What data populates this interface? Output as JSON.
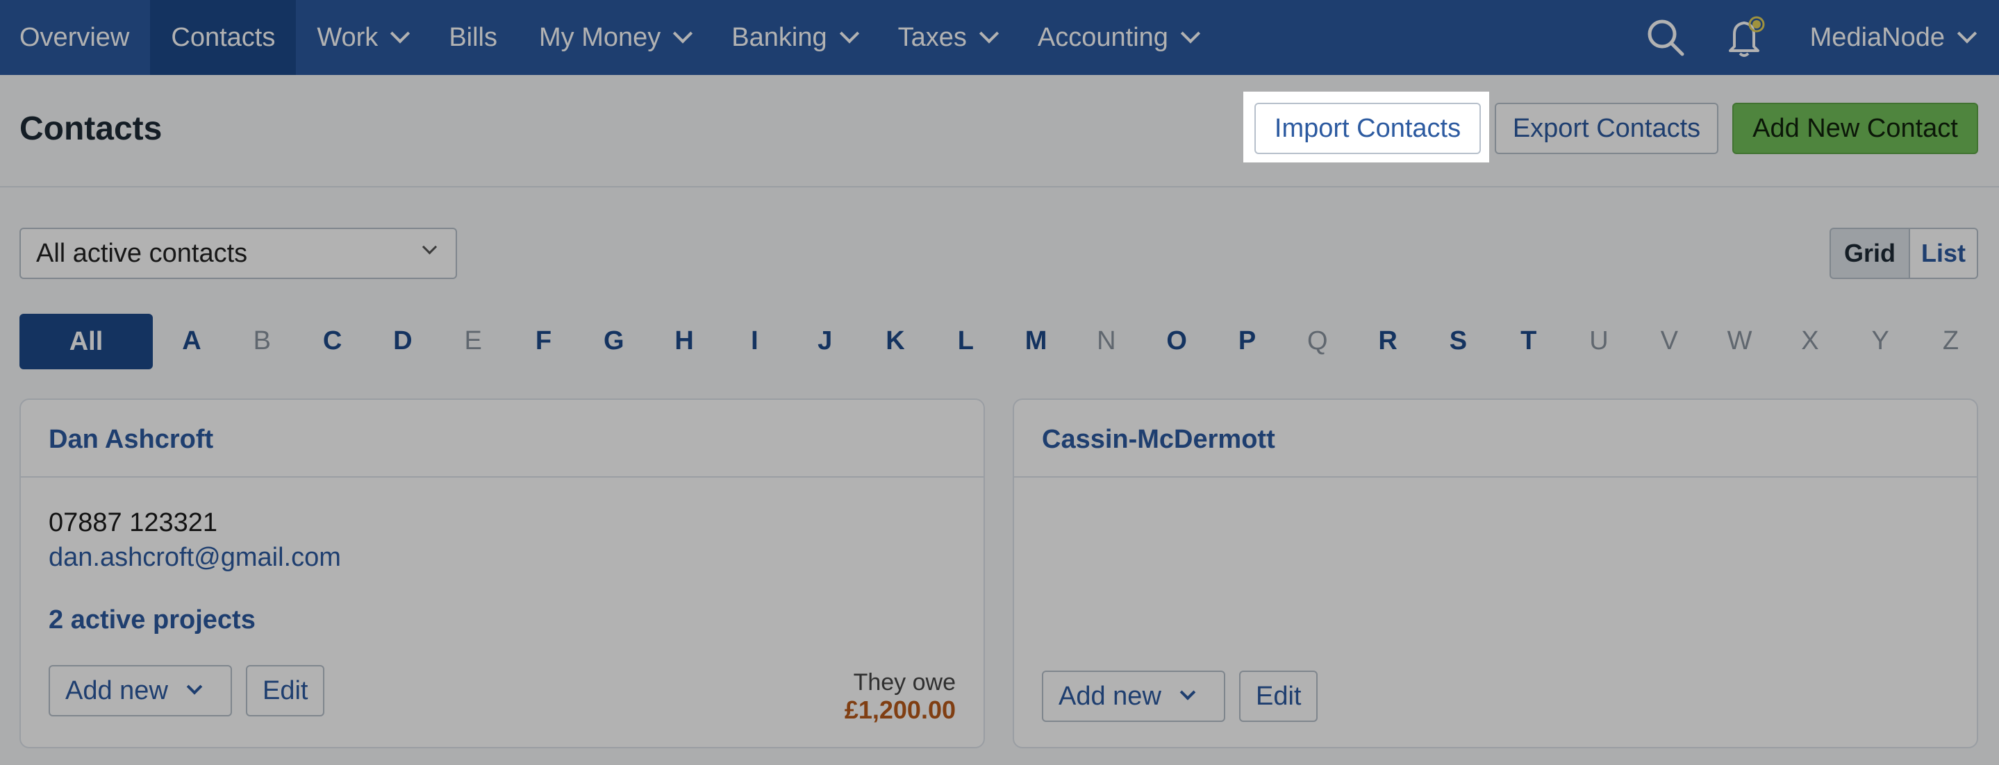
{
  "nav": {
    "items": [
      {
        "label": "Overview",
        "dropdown": false
      },
      {
        "label": "Contacts",
        "dropdown": false,
        "active": true
      },
      {
        "label": "Work",
        "dropdown": true
      },
      {
        "label": "Bills",
        "dropdown": false
      },
      {
        "label": "My Money",
        "dropdown": true
      },
      {
        "label": "Banking",
        "dropdown": true
      },
      {
        "label": "Taxes",
        "dropdown": true
      },
      {
        "label": "Accounting",
        "dropdown": true
      }
    ],
    "account_name": "MediaNode",
    "search_icon": "search-icon",
    "notification_icon": "bell-icon"
  },
  "header": {
    "title": "Contacts",
    "import_label": "Import Contacts",
    "export_label": "Export Contacts",
    "add_label": "Add New Contact"
  },
  "filter": {
    "selected": "All active contacts",
    "view_grid": "Grid",
    "view_list": "List"
  },
  "alphabet": {
    "all_label": "All",
    "letters": [
      {
        "l": "A",
        "on": true
      },
      {
        "l": "B",
        "on": false
      },
      {
        "l": "C",
        "on": true
      },
      {
        "l": "D",
        "on": true
      },
      {
        "l": "E",
        "on": false
      },
      {
        "l": "F",
        "on": true
      },
      {
        "l": "G",
        "on": true
      },
      {
        "l": "H",
        "on": true
      },
      {
        "l": "I",
        "on": true
      },
      {
        "l": "J",
        "on": true
      },
      {
        "l": "K",
        "on": true
      },
      {
        "l": "L",
        "on": true
      },
      {
        "l": "M",
        "on": true
      },
      {
        "l": "N",
        "on": false
      },
      {
        "l": "O",
        "on": true
      },
      {
        "l": "P",
        "on": true
      },
      {
        "l": "Q",
        "on": false
      },
      {
        "l": "R",
        "on": true
      },
      {
        "l": "S",
        "on": true
      },
      {
        "l": "T",
        "on": true
      },
      {
        "l": "U",
        "on": false
      },
      {
        "l": "V",
        "on": false
      },
      {
        "l": "W",
        "on": false
      },
      {
        "l": "X",
        "on": false
      },
      {
        "l": "Y",
        "on": false
      },
      {
        "l": "Z",
        "on": false
      }
    ]
  },
  "cards": [
    {
      "name": "Dan Ashcroft",
      "phone": "07887 123321",
      "email": "dan.ashcroft@gmail.com",
      "projects": "2 active projects",
      "add_new": "Add new",
      "edit": "Edit",
      "owe_label": "They owe",
      "owe_amount": "£1,200.00"
    },
    {
      "name": "Cassin-McDermott",
      "add_new": "Add new",
      "edit": "Edit"
    }
  ],
  "colors": {
    "nav_bg": "#2c5aa0",
    "nav_active": "#1d4a8a",
    "accent_green": "#72bf5a",
    "amount_orange": "#b85a1a"
  }
}
